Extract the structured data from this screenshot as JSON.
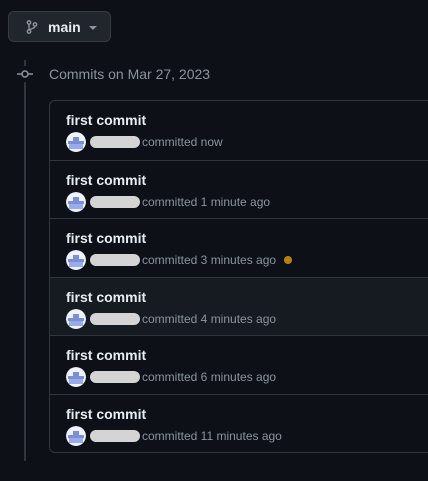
{
  "branch": {
    "name": "main"
  },
  "timeline": {
    "heading": "Commits on Mar 27, 2023"
  },
  "commits": [
    {
      "title": "first commit",
      "time": "committed now",
      "status": null
    },
    {
      "title": "first commit",
      "time": "committed 1 minute ago",
      "status": null
    },
    {
      "title": "first commit",
      "time": "committed 3 minutes ago",
      "status": "pending"
    },
    {
      "title": "first commit",
      "time": "committed 4 minutes ago",
      "status": null
    },
    {
      "title": "first commit",
      "time": "committed 6 minutes ago",
      "status": null
    },
    {
      "title": "first commit",
      "time": "committed 11 minutes ago",
      "status": null
    }
  ],
  "colors": {
    "background": "#0d1117",
    "border": "#30363d",
    "text": "#e6edf3",
    "muted": "#8b949e",
    "pending": "#bb8009",
    "hover_row": "#161b22"
  },
  "icons": {
    "branch": "git-branch-icon",
    "caret": "triangle-down-icon",
    "timeline": "git-commit-icon",
    "avatar": "user-avatar"
  }
}
